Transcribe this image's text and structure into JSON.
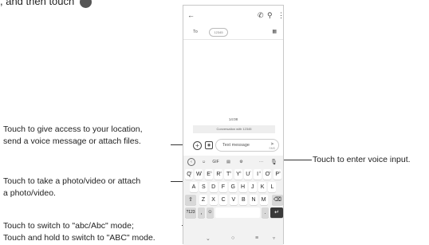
{
  "intro": {
    "text": ", and then touch"
  },
  "annotations": {
    "attach": [
      "Touch to give access to your location,",
      "send a voice message or attach files."
    ],
    "photo": [
      "Touch to take a photo/video or attach",
      "a photo/video."
    ],
    "abc": [
      "Touch to switch to \"abc/Abc\" mode;",
      "Touch and hold to switch to \"ABC\" mode."
    ],
    "voice": "Touch to enter voice input."
  },
  "phone": {
    "to_label": "To",
    "recipient": "12345",
    "time": "14:08",
    "conversation_notice": "Conversation with 12345",
    "message_placeholder": "Text message",
    "sms_label": "SMS",
    "toolbar": {
      "gif": "GIF",
      "more": "···"
    },
    "keys_row1": [
      {
        "l": "Q",
        "s": "1"
      },
      {
        "l": "W",
        "s": "2"
      },
      {
        "l": "E",
        "s": "3"
      },
      {
        "l": "R",
        "s": "4"
      },
      {
        "l": "T",
        "s": "5"
      },
      {
        "l": "Y",
        "s": "6"
      },
      {
        "l": "U",
        "s": "7"
      },
      {
        "l": "I",
        "s": "8"
      },
      {
        "l": "O",
        "s": "9"
      },
      {
        "l": "P",
        "s": "0"
      }
    ],
    "keys_row2": [
      "A",
      "S",
      "D",
      "F",
      "G",
      "H",
      "J",
      "K",
      "L"
    ],
    "keys_row3": [
      "Z",
      "X",
      "C",
      "V",
      "B",
      "N",
      "M"
    ],
    "symbols_key": "?123",
    "comma_key": ",",
    "period_key": "."
  },
  "icons": {
    "back": "arrow-left-icon",
    "call": "phone-icon",
    "search": "search-icon",
    "menu": "more-vert-icon",
    "contacts": "contacts-icon",
    "attach": "plus-icon",
    "camera": "camera-icon",
    "send": "send-icon",
    "mic": "mic-icon"
  }
}
